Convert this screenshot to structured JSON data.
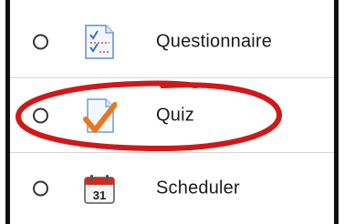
{
  "activities": [
    {
      "label": "Questionnaire",
      "icon": "questionnaire-icon"
    },
    {
      "label": "Quiz",
      "icon": "quiz-icon"
    },
    {
      "label": "Scheduler",
      "icon": "scheduler-icon",
      "calendar_day": "31"
    }
  ],
  "colors": {
    "highlight": "#d01818",
    "quiz_check": "#e8781e",
    "scheduler_red": "#d42a1a"
  }
}
